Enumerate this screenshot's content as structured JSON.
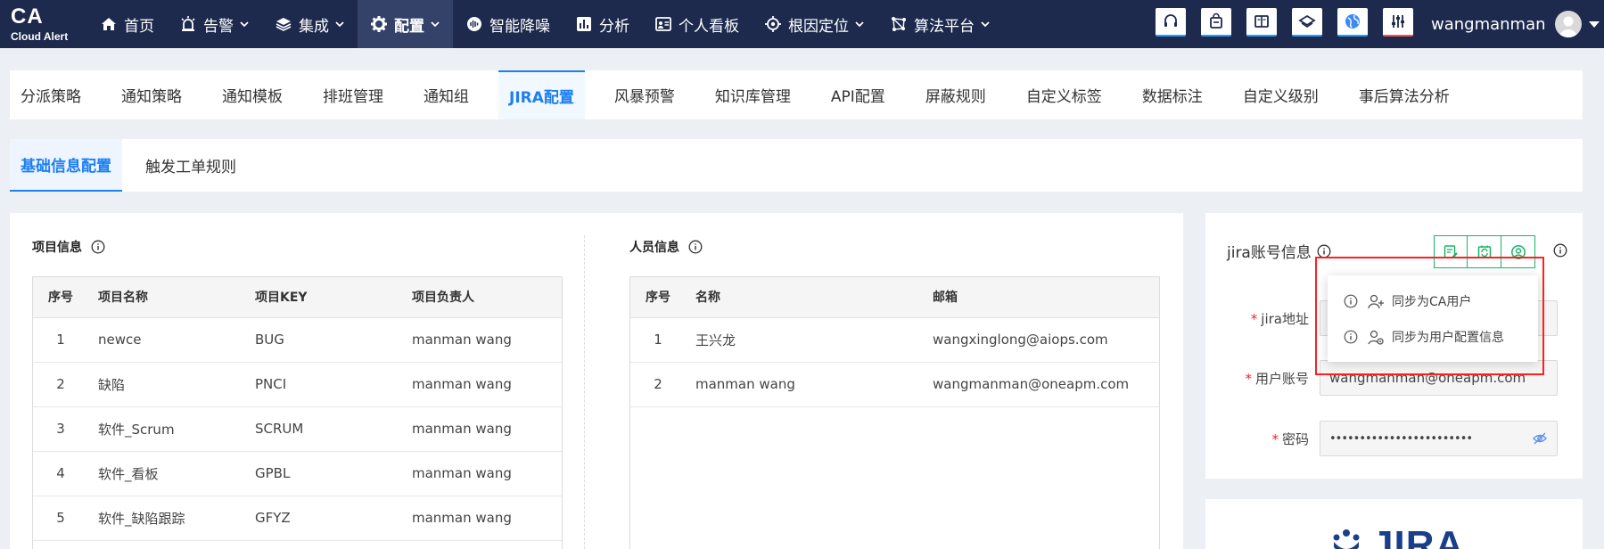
{
  "app": {
    "logo_line1": "CA",
    "logo_line2": "Cloud Alert"
  },
  "topnav": {
    "items": [
      {
        "label": "首页",
        "icon": "home-icon",
        "dropdown": false,
        "active": false
      },
      {
        "label": "告警",
        "icon": "alarm-icon",
        "dropdown": true,
        "active": false
      },
      {
        "label": "集成",
        "icon": "layers-icon",
        "dropdown": true,
        "active": false
      },
      {
        "label": "配置",
        "icon": "gear-icon",
        "dropdown": true,
        "active": true
      },
      {
        "label": "智能降噪",
        "icon": "noise-reduction-icon",
        "dropdown": false,
        "active": false
      },
      {
        "label": "分析",
        "icon": "bar-chart-icon",
        "dropdown": false,
        "active": false
      },
      {
        "label": "个人看板",
        "icon": "dashboard-icon",
        "dropdown": false,
        "active": false
      },
      {
        "label": "根因定位",
        "icon": "target-icon",
        "dropdown": true,
        "active": false
      },
      {
        "label": "算法平台",
        "icon": "algorithm-icon",
        "dropdown": true,
        "active": false
      }
    ],
    "tools": [
      "headset-icon",
      "bag-icon",
      "book-icon",
      "layers-diamond-icon",
      "globe-icon",
      "sliders-icon"
    ],
    "username": "wangmanman"
  },
  "tabs_primary": [
    {
      "label": "分派策略",
      "active": false
    },
    {
      "label": "通知策略",
      "active": false
    },
    {
      "label": "通知模板",
      "active": false
    },
    {
      "label": "排班管理",
      "active": false
    },
    {
      "label": "通知组",
      "active": false
    },
    {
      "label": "JIRA配置",
      "active": true
    },
    {
      "label": "风暴预警",
      "active": false
    },
    {
      "label": "知识库管理",
      "active": false
    },
    {
      "label": "API配置",
      "active": false
    },
    {
      "label": "屏蔽规则",
      "active": false
    },
    {
      "label": "自定义标签",
      "active": false
    },
    {
      "label": "数据标注",
      "active": false
    },
    {
      "label": "自定义级别",
      "active": false
    },
    {
      "label": "事后算法分析",
      "active": false
    }
  ],
  "tabs_secondary": [
    {
      "label": "基础信息配置",
      "active": true
    },
    {
      "label": "触发工单规则",
      "active": false
    }
  ],
  "project": {
    "title": "项目信息",
    "columns": [
      "序号",
      "项目名称",
      "项目KEY",
      "项目负责人"
    ],
    "rows": [
      [
        "1",
        "newce",
        "BUG",
        "manman wang"
      ],
      [
        "2",
        "缺陷",
        "PNCI",
        "manman wang"
      ],
      [
        "3",
        "软件_Scrum",
        "SCRUM",
        "manman wang"
      ],
      [
        "4",
        "软件_看板",
        "GPBL",
        "manman wang"
      ],
      [
        "5",
        "软件_缺陷跟踪",
        "GFYZ",
        "manman wang"
      ]
    ]
  },
  "people": {
    "title": "人员信息",
    "columns": [
      "序号",
      "名称",
      "邮箱"
    ],
    "rows": [
      [
        "1",
        "王兴龙",
        "wangxinglong@aiops.com"
      ],
      [
        "2",
        "manman wang",
        "wangmanman@oneapm.com"
      ]
    ]
  },
  "jira_account": {
    "title": "jira账号信息",
    "fields": {
      "url_label": "jira地址",
      "user_label": "用户账号",
      "user_value": "wangmanman@oneapm.com",
      "password_label": "密码",
      "password_value": "••••••••••••••••••••••••"
    },
    "menu": [
      {
        "label": "同步为CA用户",
        "icon": "user-add-icon"
      },
      {
        "label": "同步为用户配置信息",
        "icon": "user-settings-icon"
      }
    ]
  },
  "jira_logo": {
    "text": "JIRA"
  },
  "colors": {
    "nav_bg": "#1d2a4d",
    "accent": "#1d7ff2",
    "green": "#19b36b",
    "highlight": "#ff1f1f"
  }
}
